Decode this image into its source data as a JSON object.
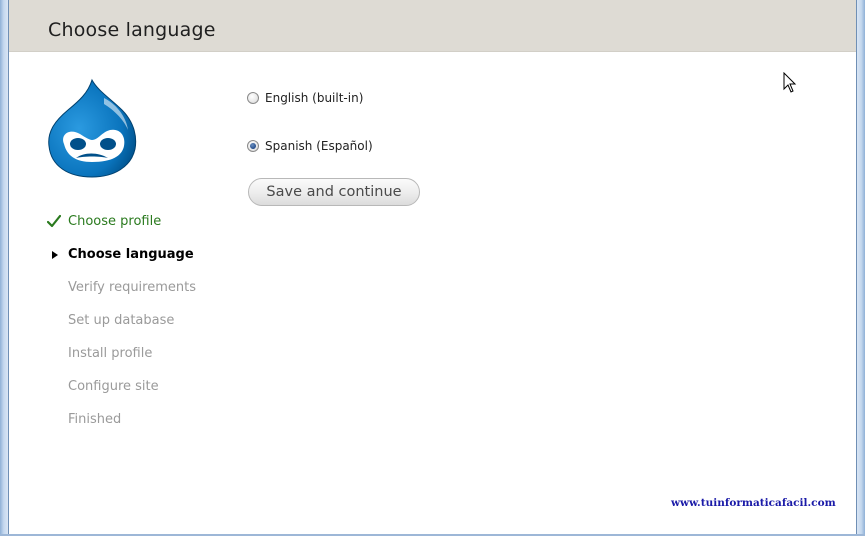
{
  "header": {
    "title": "Choose language"
  },
  "logo": {
    "icon": "drupal-drop-icon",
    "color": "#0073ba"
  },
  "steps": [
    {
      "label": "Choose profile",
      "state": "done"
    },
    {
      "label": "Choose language",
      "state": "active"
    },
    {
      "label": "Verify requirements",
      "state": "pending"
    },
    {
      "label": "Set up database",
      "state": "pending"
    },
    {
      "label": "Install profile",
      "state": "pending"
    },
    {
      "label": "Configure site",
      "state": "pending"
    },
    {
      "label": "Finished",
      "state": "pending"
    }
  ],
  "languages": {
    "selected": "Spanish (Español)",
    "options": [
      {
        "label": "English (built-in)",
        "checked": false
      },
      {
        "label": "Spanish (Español)",
        "checked": true
      }
    ]
  },
  "actions": {
    "save_label": "Save and continue"
  },
  "footer": {
    "watermark": "www.tuinformaticafacil.com"
  }
}
